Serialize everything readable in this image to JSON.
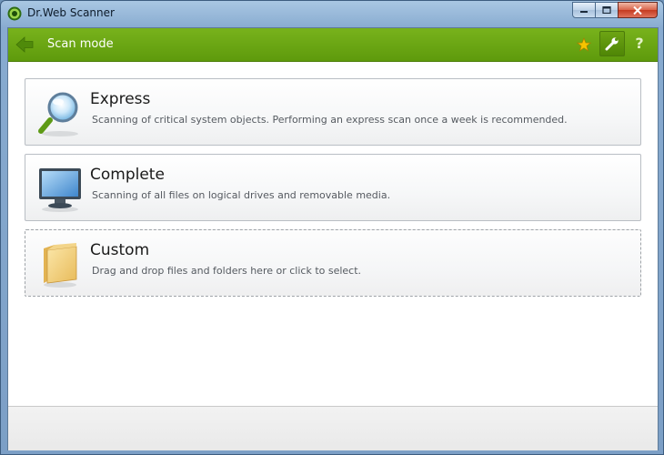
{
  "window": {
    "title": "Dr.Web Scanner"
  },
  "header": {
    "title": "Scan mode",
    "help_label": "?"
  },
  "modes": [
    {
      "title": "Express",
      "description": "Scanning of critical system objects. Performing an express scan once a week is recommended.",
      "icon": "magnifier-icon"
    },
    {
      "title": "Complete",
      "description": "Scanning of all files on logical drives and removable media.",
      "icon": "monitor-icon"
    },
    {
      "title": "Custom",
      "description": "Drag and drop files and folders here or click to select.",
      "icon": "folder-icon"
    }
  ],
  "colors": {
    "accent_green": "#6aa812",
    "star": "#f5c400"
  }
}
